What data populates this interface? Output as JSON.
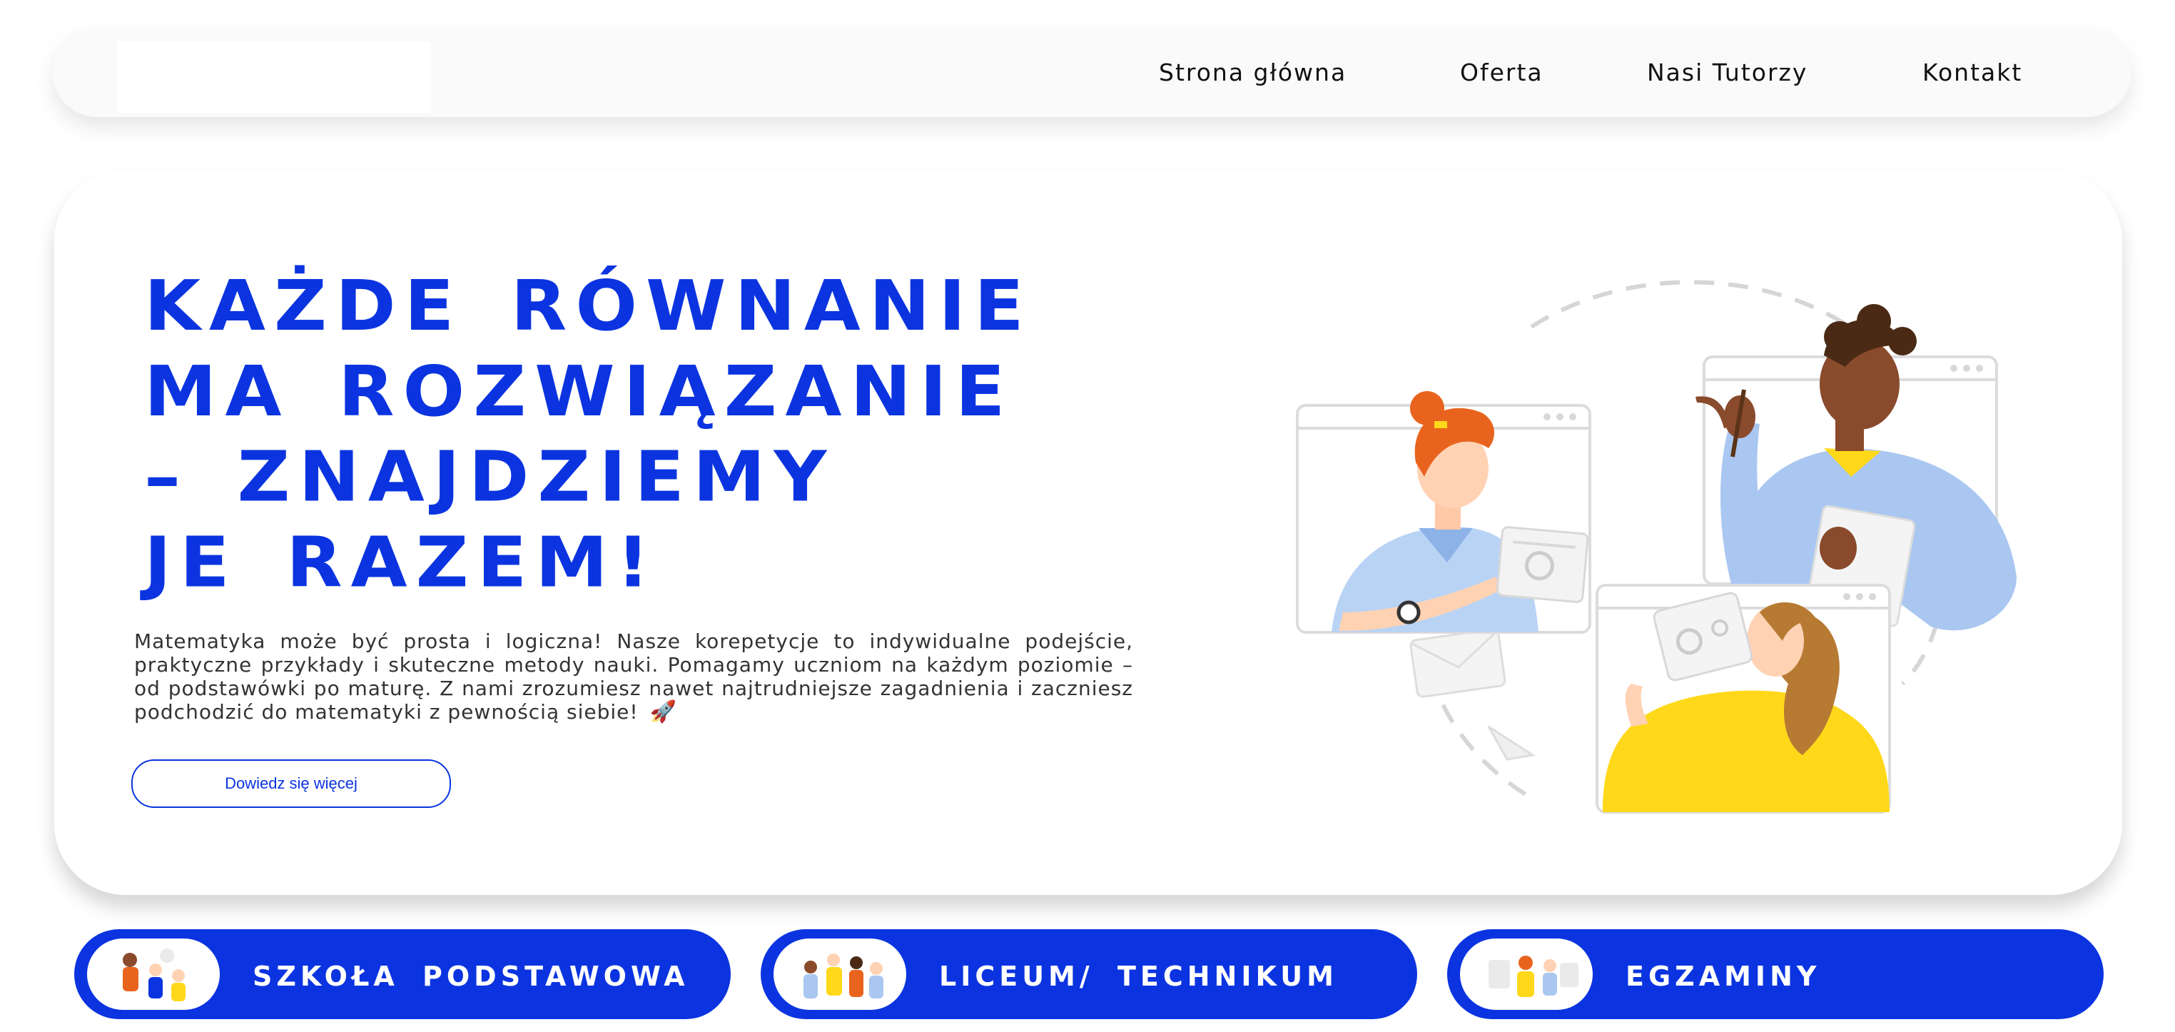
{
  "nav": {
    "items": [
      {
        "label": "Strona główna"
      },
      {
        "label": "Oferta"
      },
      {
        "label": "Nasi Tutorzy"
      },
      {
        "label": "Kontakt"
      }
    ]
  },
  "hero": {
    "headline_lines": [
      "KAŻDE RÓWNANIE",
      "MA ROZWIĄZANIE",
      "– ZNAJDZIEMY",
      "JE RAZEM!"
    ],
    "body": "Matematyka może być prosta i logiczna! Nasze korepetycje to indywidualne podejście, praktyczne przykłady i skuteczne metody nauki. Pomagamy uczniom na każdym poziomie – od podstawówki po maturę. Z nami zrozumiesz nawet najtrudniejsze zagadnienia i zaczniesz podchodzić do matematyki z pewnością siebie!",
    "rocket": "🚀",
    "cta_label": "Dowiedz się więcej"
  },
  "categories": [
    {
      "label": "SZKOŁA PODSTAWOWA",
      "icon": "students-illustration"
    },
    {
      "label": "LICEUM/ TECHNIKUM",
      "icon": "teens-illustration"
    },
    {
      "label": "EGZAMINY",
      "icon": "exam-group-illustration"
    }
  ],
  "colors": {
    "brand_blue": "#0b34e0",
    "shirt_light_blue": "#a9c7f0",
    "shirt_yellow": "#ffd81a",
    "hair_orange": "#e8641e",
    "skin_dark": "#8a4a2c"
  }
}
